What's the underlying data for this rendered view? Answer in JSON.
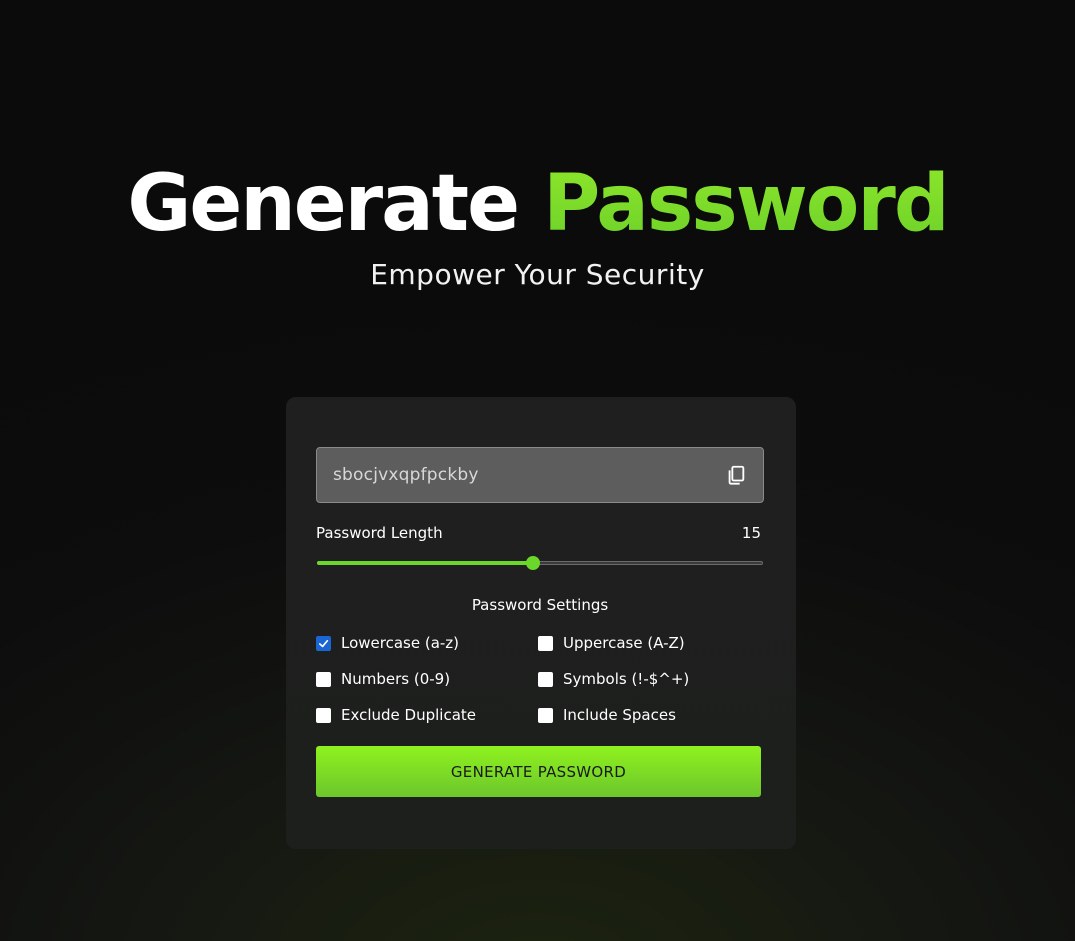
{
  "hero": {
    "title_part1": "Generate",
    "title_part2": "Password",
    "subtitle": "Empower Your Security"
  },
  "generator": {
    "password_value": "sbocjvxqpfpckby",
    "copy_icon": "copy-icon",
    "length_label": "Password Length",
    "length_value": "15",
    "slider_fraction": 0.485,
    "settings_title": "Password Settings",
    "options": [
      {
        "label": "Lowercase (a-z)",
        "checked": true
      },
      {
        "label": "Uppercase (A-Z)",
        "checked": false
      },
      {
        "label": "Numbers (0-9)",
        "checked": false
      },
      {
        "label": "Symbols (!-$^+)",
        "checked": false
      },
      {
        "label": "Exclude Duplicate",
        "checked": false
      },
      {
        "label": "Include Spaces",
        "checked": false
      }
    ],
    "button_label": "GENERATE PASSWORD"
  },
  "colors": {
    "accent": "#6bd72b",
    "checkbox_checked": "#1a66d2",
    "background": "#0d0d0d",
    "card": "#1e1f1e"
  }
}
